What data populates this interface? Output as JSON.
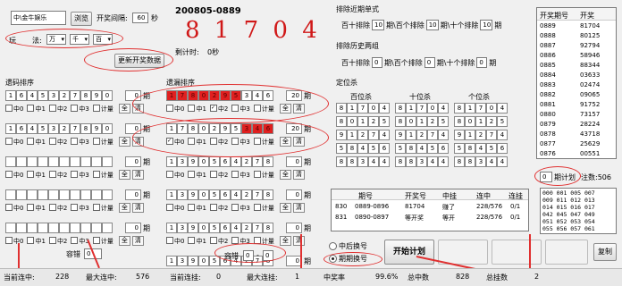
{
  "top": {
    "combo_text": "中\\金牛娱乐",
    "browse": "浏览",
    "interval_label": "开奖间隔:",
    "interval_value": "60",
    "interval_unit": "秒",
    "method_label": "玩",
    "method_label2": "法:",
    "method_sel1": "万",
    "method_sel2": "千",
    "method_sel3": "百",
    "update_btn": "更新开奖数据"
  },
  "draw": {
    "period": "200805-0889",
    "number": "8 1 7 0 4",
    "countdown_label": "剩计时:",
    "countdown_value": "0秒"
  },
  "left": {
    "title": "遗码排序",
    "rows": [
      {
        "cells": [
          "1",
          "6",
          "4",
          "5",
          "3",
          "2",
          "7",
          "8",
          "9",
          "0"
        ],
        "period": "0",
        "plan": "期"
      },
      {
        "cells": [
          "1",
          "6",
          "4",
          "5",
          "3",
          "2",
          "7",
          "8",
          "9",
          "0"
        ],
        "period": "0",
        "plan": "期"
      },
      {
        "cells": [
          "",
          "",
          "",
          "",
          "",
          "",
          "",
          "",
          "",
          ""
        ],
        "period": "0",
        "plan": "期"
      },
      {
        "cells": [
          "",
          "",
          "",
          "",
          "",
          "",
          "",
          "",
          "",
          ""
        ],
        "period": "0",
        "plan": "期"
      },
      {
        "cells": [
          "",
          "",
          "",
          "",
          "",
          "",
          "",
          "",
          "",
          ""
        ],
        "period": "0",
        "plan": "期"
      }
    ],
    "checks": [
      "中0",
      "中1",
      "中2",
      "中3",
      "计量"
    ],
    "all": "全",
    "clear": "清",
    "bet_label": "容错",
    "bet_value": "0"
  },
  "mid": {
    "title": "遗漏排序",
    "rows": [
      {
        "cells": [
          "1",
          "7",
          "8",
          "0",
          "2",
          "9",
          "5",
          "3",
          "4",
          "6"
        ],
        "period": "20",
        "plan": "期"
      },
      {
        "cells": [
          "1",
          "7",
          "8",
          "0",
          "2",
          "9",
          "5",
          "3",
          "4",
          "6"
        ],
        "period": "20",
        "plan": "期"
      },
      {
        "cells": [
          "1",
          "3",
          "9",
          "0",
          "5",
          "6",
          "4",
          "2",
          "7",
          "8"
        ],
        "period": "0",
        "plan": "期"
      },
      {
        "cells": [
          "1",
          "3",
          "9",
          "0",
          "5",
          "6",
          "4",
          "2",
          "7",
          "8"
        ],
        "period": "0",
        "plan": "期"
      },
      {
        "cells": [
          "1",
          "3",
          "9",
          "0",
          "5",
          "6",
          "4",
          "2",
          "7",
          "8"
        ],
        "period": "0",
        "plan": "期"
      },
      {
        "cells": [
          "1",
          "3",
          "9",
          "0",
          "5",
          "6",
          "4",
          "2",
          "7",
          "8"
        ],
        "period": "0",
        "plan": "期"
      }
    ],
    "checks": [
      "中0",
      "中1",
      "中2",
      "中3",
      "计量"
    ],
    "all": "全",
    "clear": "清",
    "bet_label": "容错",
    "bet_value": "0",
    "bet_value2": "0"
  },
  "exclude": {
    "title1": "排除近期单式",
    "row1_prefix": "百十排除",
    "row1_v1": "10",
    "row1_t1": "期\\百个排除",
    "row1_v2": "10",
    "row1_t2": "期\\十个排除",
    "row1_v3": "10",
    "row1_t3": "期",
    "title2": "排除历史两组",
    "row2_prefix": "百十排除",
    "row2_v1": "0",
    "row2_t1": "期\\百个排除",
    "row2_v2": "0",
    "row2_t2": "期\\十个排除",
    "row2_v3": "0",
    "row2_t3": "期"
  },
  "pos": {
    "title": "定位杀",
    "h1": "百位杀",
    "h2": "十位杀",
    "h3": "个位杀",
    "grid": [
      [
        "8",
        "1",
        "7",
        "0",
        "4"
      ],
      [
        "8",
        "0",
        "1",
        "2",
        "5"
      ],
      [
        "9",
        "1",
        "2",
        "7",
        "4"
      ],
      [
        "5",
        "8",
        "4",
        "5",
        "6"
      ],
      [
        "8",
        "8",
        "3",
        "4",
        "4"
      ]
    ]
  },
  "history": {
    "headers": [
      "期号",
      "开奖号",
      "中挂",
      "连中",
      "连挂"
    ],
    "rows": [
      [
        "830",
        "0889-0896",
        "81704",
        "赚了",
        "228/576",
        "0/1"
      ],
      [
        "831",
        "0890-0897",
        "等开奖",
        "等开",
        "228/576",
        "0/1"
      ]
    ]
  },
  "right": {
    "headers": [
      "开奖期号",
      "开奖"
    ],
    "rows": [
      [
        "0889",
        "81704"
      ],
      [
        "0888",
        "80125"
      ],
      [
        "0887",
        "92794"
      ],
      [
        "0886",
        "58946"
      ],
      [
        "0885",
        "88344"
      ],
      [
        "0884",
        "03633"
      ],
      [
        "0883",
        "02474"
      ],
      [
        "0882",
        "09065"
      ],
      [
        "0881",
        "91752"
      ],
      [
        "0880",
        "73157"
      ],
      [
        "0879",
        "28224"
      ],
      [
        "0878",
        "43718"
      ],
      [
        "0877",
        "25629"
      ],
      [
        "0876",
        "00551"
      ]
    ],
    "plan_value": "0",
    "plan_label": "期计划",
    "count_label": "注数:",
    "count_value": "506",
    "combos": "000 001 005 007\n009 011 012 013\n014 015 016 017\n042 045 047 049\n051 052 053 054\n055 056 057 061"
  },
  "controls": {
    "radio1": "中后换号",
    "radio2": "期期换号",
    "start": "开始计划",
    "copy": "复制"
  },
  "status": {
    "s1": "当前连中:",
    "v1": "228",
    "s2": "最大连中:",
    "v2": "576",
    "s3": "当前连挂:",
    "v3": "0",
    "s4": "最大连挂:",
    "v4": "1",
    "s5": "中奖率",
    "v5": "99.6%",
    "s6": "总中数",
    "v6": "828",
    "s7": "总挂数",
    "v7": "2"
  }
}
